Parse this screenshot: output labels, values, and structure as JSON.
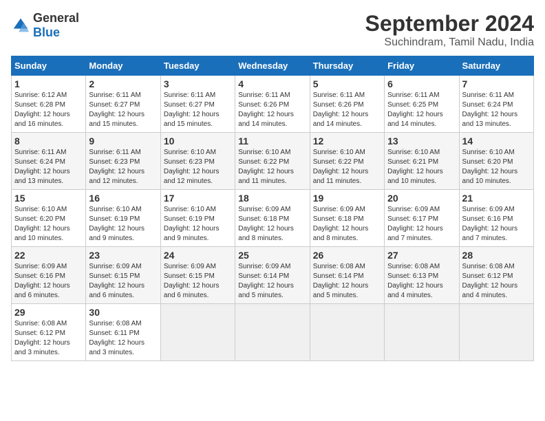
{
  "logo": {
    "general": "General",
    "blue": "Blue"
  },
  "title": "September 2024",
  "subtitle": "Suchindram, Tamil Nadu, India",
  "days_of_week": [
    "Sunday",
    "Monday",
    "Tuesday",
    "Wednesday",
    "Thursday",
    "Friday",
    "Saturday"
  ],
  "weeks": [
    [
      {
        "num": "1",
        "sunrise": "6:12 AM",
        "sunset": "6:28 PM",
        "daylight": "12 hours and 16 minutes."
      },
      {
        "num": "2",
        "sunrise": "6:11 AM",
        "sunset": "6:27 PM",
        "daylight": "12 hours and 15 minutes."
      },
      {
        "num": "3",
        "sunrise": "6:11 AM",
        "sunset": "6:27 PM",
        "daylight": "12 hours and 15 minutes."
      },
      {
        "num": "4",
        "sunrise": "6:11 AM",
        "sunset": "6:26 PM",
        "daylight": "12 hours and 14 minutes."
      },
      {
        "num": "5",
        "sunrise": "6:11 AM",
        "sunset": "6:26 PM",
        "daylight": "12 hours and 14 minutes."
      },
      {
        "num": "6",
        "sunrise": "6:11 AM",
        "sunset": "6:25 PM",
        "daylight": "12 hours and 14 minutes."
      },
      {
        "num": "7",
        "sunrise": "6:11 AM",
        "sunset": "6:24 PM",
        "daylight": "12 hours and 13 minutes."
      }
    ],
    [
      {
        "num": "8",
        "sunrise": "6:11 AM",
        "sunset": "6:24 PM",
        "daylight": "12 hours and 13 minutes."
      },
      {
        "num": "9",
        "sunrise": "6:11 AM",
        "sunset": "6:23 PM",
        "daylight": "12 hours and 12 minutes."
      },
      {
        "num": "10",
        "sunrise": "6:10 AM",
        "sunset": "6:23 PM",
        "daylight": "12 hours and 12 minutes."
      },
      {
        "num": "11",
        "sunrise": "6:10 AM",
        "sunset": "6:22 PM",
        "daylight": "12 hours and 11 minutes."
      },
      {
        "num": "12",
        "sunrise": "6:10 AM",
        "sunset": "6:22 PM",
        "daylight": "12 hours and 11 minutes."
      },
      {
        "num": "13",
        "sunrise": "6:10 AM",
        "sunset": "6:21 PM",
        "daylight": "12 hours and 10 minutes."
      },
      {
        "num": "14",
        "sunrise": "6:10 AM",
        "sunset": "6:20 PM",
        "daylight": "12 hours and 10 minutes."
      }
    ],
    [
      {
        "num": "15",
        "sunrise": "6:10 AM",
        "sunset": "6:20 PM",
        "daylight": "12 hours and 10 minutes."
      },
      {
        "num": "16",
        "sunrise": "6:10 AM",
        "sunset": "6:19 PM",
        "daylight": "12 hours and 9 minutes."
      },
      {
        "num": "17",
        "sunrise": "6:10 AM",
        "sunset": "6:19 PM",
        "daylight": "12 hours and 9 minutes."
      },
      {
        "num": "18",
        "sunrise": "6:09 AM",
        "sunset": "6:18 PM",
        "daylight": "12 hours and 8 minutes."
      },
      {
        "num": "19",
        "sunrise": "6:09 AM",
        "sunset": "6:18 PM",
        "daylight": "12 hours and 8 minutes."
      },
      {
        "num": "20",
        "sunrise": "6:09 AM",
        "sunset": "6:17 PM",
        "daylight": "12 hours and 7 minutes."
      },
      {
        "num": "21",
        "sunrise": "6:09 AM",
        "sunset": "6:16 PM",
        "daylight": "12 hours and 7 minutes."
      }
    ],
    [
      {
        "num": "22",
        "sunrise": "6:09 AM",
        "sunset": "6:16 PM",
        "daylight": "12 hours and 6 minutes."
      },
      {
        "num": "23",
        "sunrise": "6:09 AM",
        "sunset": "6:15 PM",
        "daylight": "12 hours and 6 minutes."
      },
      {
        "num": "24",
        "sunrise": "6:09 AM",
        "sunset": "6:15 PM",
        "daylight": "12 hours and 6 minutes."
      },
      {
        "num": "25",
        "sunrise": "6:09 AM",
        "sunset": "6:14 PM",
        "daylight": "12 hours and 5 minutes."
      },
      {
        "num": "26",
        "sunrise": "6:08 AM",
        "sunset": "6:14 PM",
        "daylight": "12 hours and 5 minutes."
      },
      {
        "num": "27",
        "sunrise": "6:08 AM",
        "sunset": "6:13 PM",
        "daylight": "12 hours and 4 minutes."
      },
      {
        "num": "28",
        "sunrise": "6:08 AM",
        "sunset": "6:12 PM",
        "daylight": "12 hours and 4 minutes."
      }
    ],
    [
      {
        "num": "29",
        "sunrise": "6:08 AM",
        "sunset": "6:12 PM",
        "daylight": "12 hours and 3 minutes."
      },
      {
        "num": "30",
        "sunrise": "6:08 AM",
        "sunset": "6:11 PM",
        "daylight": "12 hours and 3 minutes."
      },
      null,
      null,
      null,
      null,
      null
    ]
  ]
}
